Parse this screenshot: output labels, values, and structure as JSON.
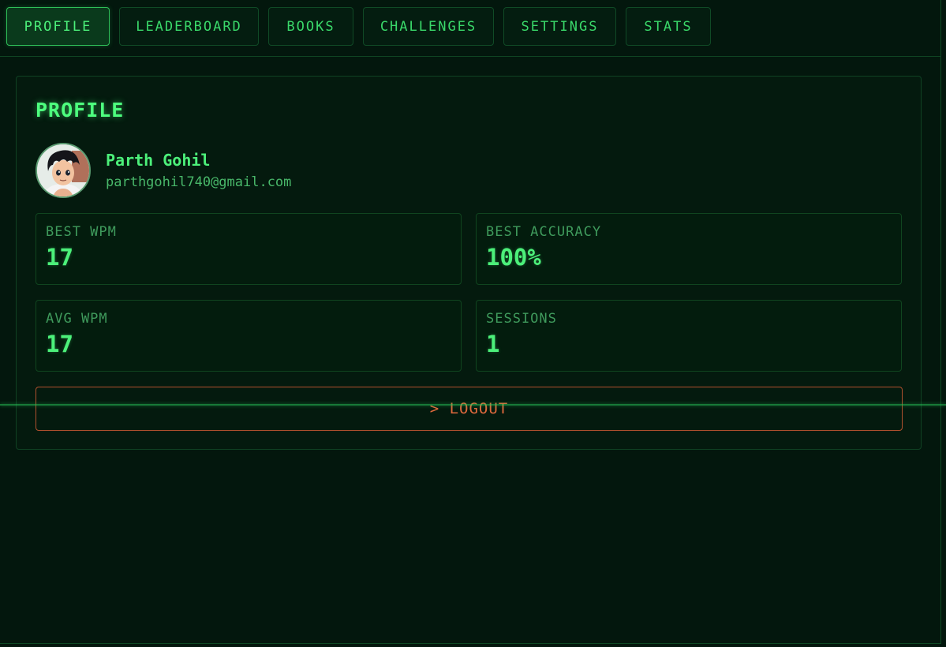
{
  "tabs": [
    {
      "label": "PROFILE",
      "active": true
    },
    {
      "label": "LEADERBOARD",
      "active": false
    },
    {
      "label": "BOOKS",
      "active": false
    },
    {
      "label": "CHALLENGES",
      "active": false
    },
    {
      "label": "SETTINGS",
      "active": false
    },
    {
      "label": "STATS",
      "active": false
    }
  ],
  "profile": {
    "title": "PROFILE",
    "name": "Parth Gohil",
    "email": "parthgohil740@gmail.com",
    "avatar_icon": "user-avatar-icon"
  },
  "stats": [
    {
      "label": "BEST WPM",
      "value": "17"
    },
    {
      "label": "BEST ACCURACY",
      "value": "100%"
    },
    {
      "label": "AVG WPM",
      "value": "17"
    },
    {
      "label": "SESSIONS",
      "value": "1"
    }
  ],
  "logout_label": "> LOGOUT",
  "colors": {
    "background": "#03170d",
    "accent": "#4cf07a",
    "logout": "#e0693d"
  }
}
